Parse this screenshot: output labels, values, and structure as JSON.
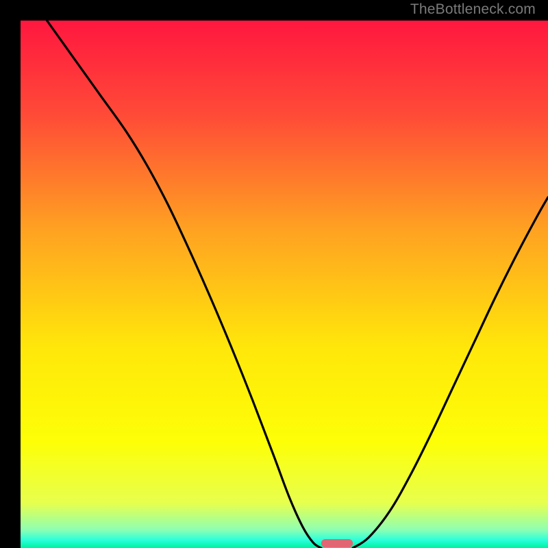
{
  "watermark": "TheBottleneck.com",
  "chart_data": {
    "type": "line",
    "title": "",
    "xlabel": "",
    "ylabel": "",
    "xlim": [
      0,
      100
    ],
    "ylim": [
      0,
      100
    ],
    "background_gradient": {
      "stops": [
        {
          "offset": 0.0,
          "color": "#ff173f"
        },
        {
          "offset": 0.18,
          "color": "#ff4b37"
        },
        {
          "offset": 0.4,
          "color": "#ffa321"
        },
        {
          "offset": 0.62,
          "color": "#ffe70a"
        },
        {
          "offset": 0.8,
          "color": "#fdff07"
        },
        {
          "offset": 0.915,
          "color": "#e7ff4e"
        },
        {
          "offset": 0.965,
          "color": "#8fffb2"
        },
        {
          "offset": 0.985,
          "color": "#2affdc"
        },
        {
          "offset": 1.0,
          "color": "#00f1a0"
        }
      ]
    },
    "series": [
      {
        "name": "left-curve",
        "x": [
          5.0,
          10.0,
          15.0,
          20.0,
          24.0,
          28.0,
          32.0,
          36.0,
          40.0,
          44.0,
          48.0,
          51.0,
          53.5,
          55.5,
          57.0
        ],
        "y": [
          100.0,
          93.0,
          86.0,
          79.0,
          72.5,
          65.0,
          56.5,
          47.5,
          38.0,
          28.0,
          17.5,
          9.5,
          4.0,
          1.0,
          0.0
        ]
      },
      {
        "name": "right-curve",
        "x": [
          63.0,
          66.0,
          70.0,
          74.0,
          78.0,
          82.0,
          86.0,
          90.0,
          94.0,
          98.0,
          100.0
        ],
        "y": [
          0.0,
          2.0,
          7.0,
          14.0,
          22.0,
          30.5,
          39.0,
          47.5,
          55.5,
          63.0,
          66.5
        ]
      }
    ],
    "marker": {
      "name": "bottleneck-marker",
      "x_center": 60.0,
      "width": 6.0,
      "color": "#e06673"
    }
  }
}
